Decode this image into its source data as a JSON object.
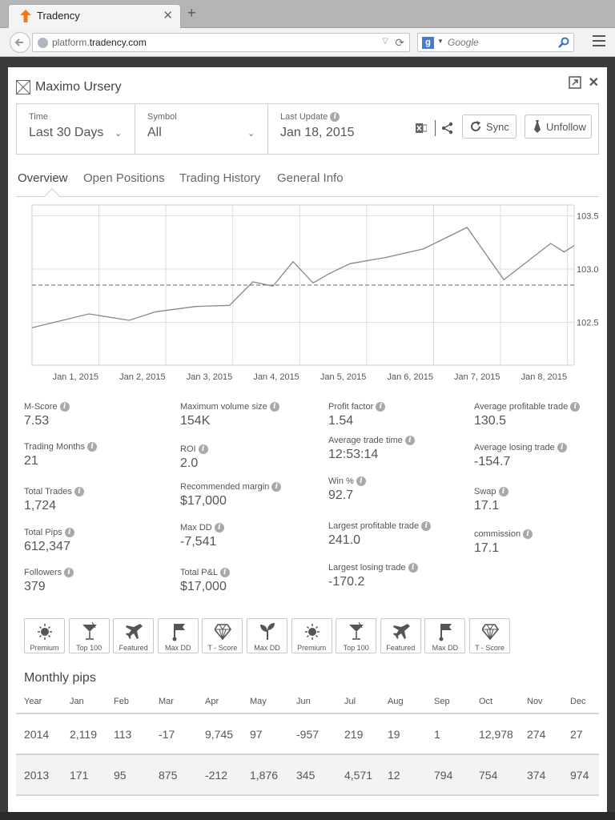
{
  "browser": {
    "tab_title": "Tradency",
    "url_host_prefix": "platform.",
    "url_host_main": "tradency.com",
    "search_placeholder": "Google",
    "search_engine_letter": "g"
  },
  "header": {
    "trader_name": "Maximo Ursery"
  },
  "filters": {
    "time_label": "Time",
    "time_value": "Last 30 Days",
    "symbol_label": "Symbol",
    "symbol_value": "All",
    "update_label": "Last Update",
    "update_value": "Jan 18, 2015",
    "sync_label": "Sync",
    "unfollow_label": "Unfollow"
  },
  "tabs": [
    "Overview",
    "Open Positions",
    "Trading History",
    "General Info"
  ],
  "chart_data": {
    "type": "line",
    "x_tick_labels": [
      "Jan 1, 2015",
      "Jan 2, 2015",
      "Jan 3, 2015",
      "Jan 4, 2015",
      "Jan 5, 2015",
      "Jan 6, 2015",
      "Jan 7, 2015",
      "Jan 8, 2015"
    ],
    "y_tick_labels": [
      "103.5",
      "103.0",
      "102.5"
    ],
    "y_ticks": [
      103.5,
      103.0,
      102.5
    ],
    "ylim": [
      102.1,
      103.6
    ],
    "xlim": [
      0.0,
      8.1
    ],
    "reference_line": 102.85,
    "grid": true,
    "series": [
      {
        "x": [
          0.0,
          0.85,
          1.45,
          1.85,
          2.45,
          2.95,
          3.3,
          3.6,
          3.9,
          4.2,
          4.45,
          4.75,
          5.3,
          5.85,
          6.5,
          7.05,
          7.5,
          7.75,
          7.95,
          8.1
        ],
        "y": [
          102.45,
          102.58,
          102.52,
          102.6,
          102.65,
          102.66,
          102.88,
          102.84,
          103.07,
          102.87,
          102.96,
          103.05,
          103.11,
          103.19,
          103.39,
          102.9,
          103.12,
          103.24,
          103.16,
          103.22
        ]
      }
    ]
  },
  "stats": [
    {
      "label": "M-Score",
      "value": "7.53"
    },
    {
      "label": "Trading Months",
      "value": "21"
    },
    {
      "label": "Total Trades",
      "value": "1,724"
    },
    {
      "label": "Total Pips",
      "value": "612,347"
    },
    {
      "label": "Followers",
      "value": "379"
    },
    {
      "label": "Maximum volume size",
      "value": "154K"
    },
    {
      "label": "ROI",
      "value": "2.0"
    },
    {
      "label": "Recommended margin",
      "value": "$17,000"
    },
    {
      "label": "Max DD",
      "value": "-7,541"
    },
    {
      "label": "Total P&L",
      "value": "$17,000"
    },
    {
      "label": "Profit factor",
      "value": "1.54"
    },
    {
      "label": "Average trade time",
      "value": "12:53:14"
    },
    {
      "label": "Win %",
      "value": "92.7"
    },
    {
      "label": "Largest profitable trade",
      "value": "241.0"
    },
    {
      "label": "Largest losing trade",
      "value": "-170.2"
    },
    {
      "label": "Average profitable trade",
      "value": "130.5"
    },
    {
      "label": "Average losing trade",
      "value": "-154.7"
    },
    {
      "label": "Swap",
      "value": "17.1"
    },
    {
      "label": "commission",
      "value": "17.1"
    }
  ],
  "badges": [
    {
      "label": "Premium",
      "icon": "sun-icon"
    },
    {
      "label": "Top 100",
      "icon": "cocktail-icon"
    },
    {
      "label": "Featured",
      "icon": "airplane-icon"
    },
    {
      "label": "Max DD",
      "icon": "flag-icon"
    },
    {
      "label": "T - Score",
      "icon": "diamond-icon"
    },
    {
      "label": "Max DD",
      "icon": "sprout-icon"
    },
    {
      "label": "Premium",
      "icon": "sun-icon"
    },
    {
      "label": "Top 100",
      "icon": "cocktail-icon"
    },
    {
      "label": "Featured",
      "icon": "airplane-icon"
    },
    {
      "label": "Max DD",
      "icon": "flag-icon"
    },
    {
      "label": "T - Score",
      "icon": "diamond-icon"
    }
  ],
  "monthly": {
    "title": "Monthly pips",
    "headers": [
      "Year",
      "Jan",
      "Feb",
      "Mar",
      "Apr",
      "May",
      "Jun",
      "Jul",
      "Aug",
      "Sep",
      "Oct",
      "Nov",
      "Dec"
    ],
    "rows": [
      [
        "2014",
        "2,119",
        "113",
        "-17",
        "9,745",
        "97",
        "-957",
        "219",
        "19",
        "1",
        "12,978",
        "274",
        "27"
      ],
      [
        "2013",
        "171",
        "95",
        "875",
        "-212",
        "1,876",
        "345",
        "4,571",
        "12",
        "794",
        "754",
        "374",
        "974"
      ]
    ]
  }
}
